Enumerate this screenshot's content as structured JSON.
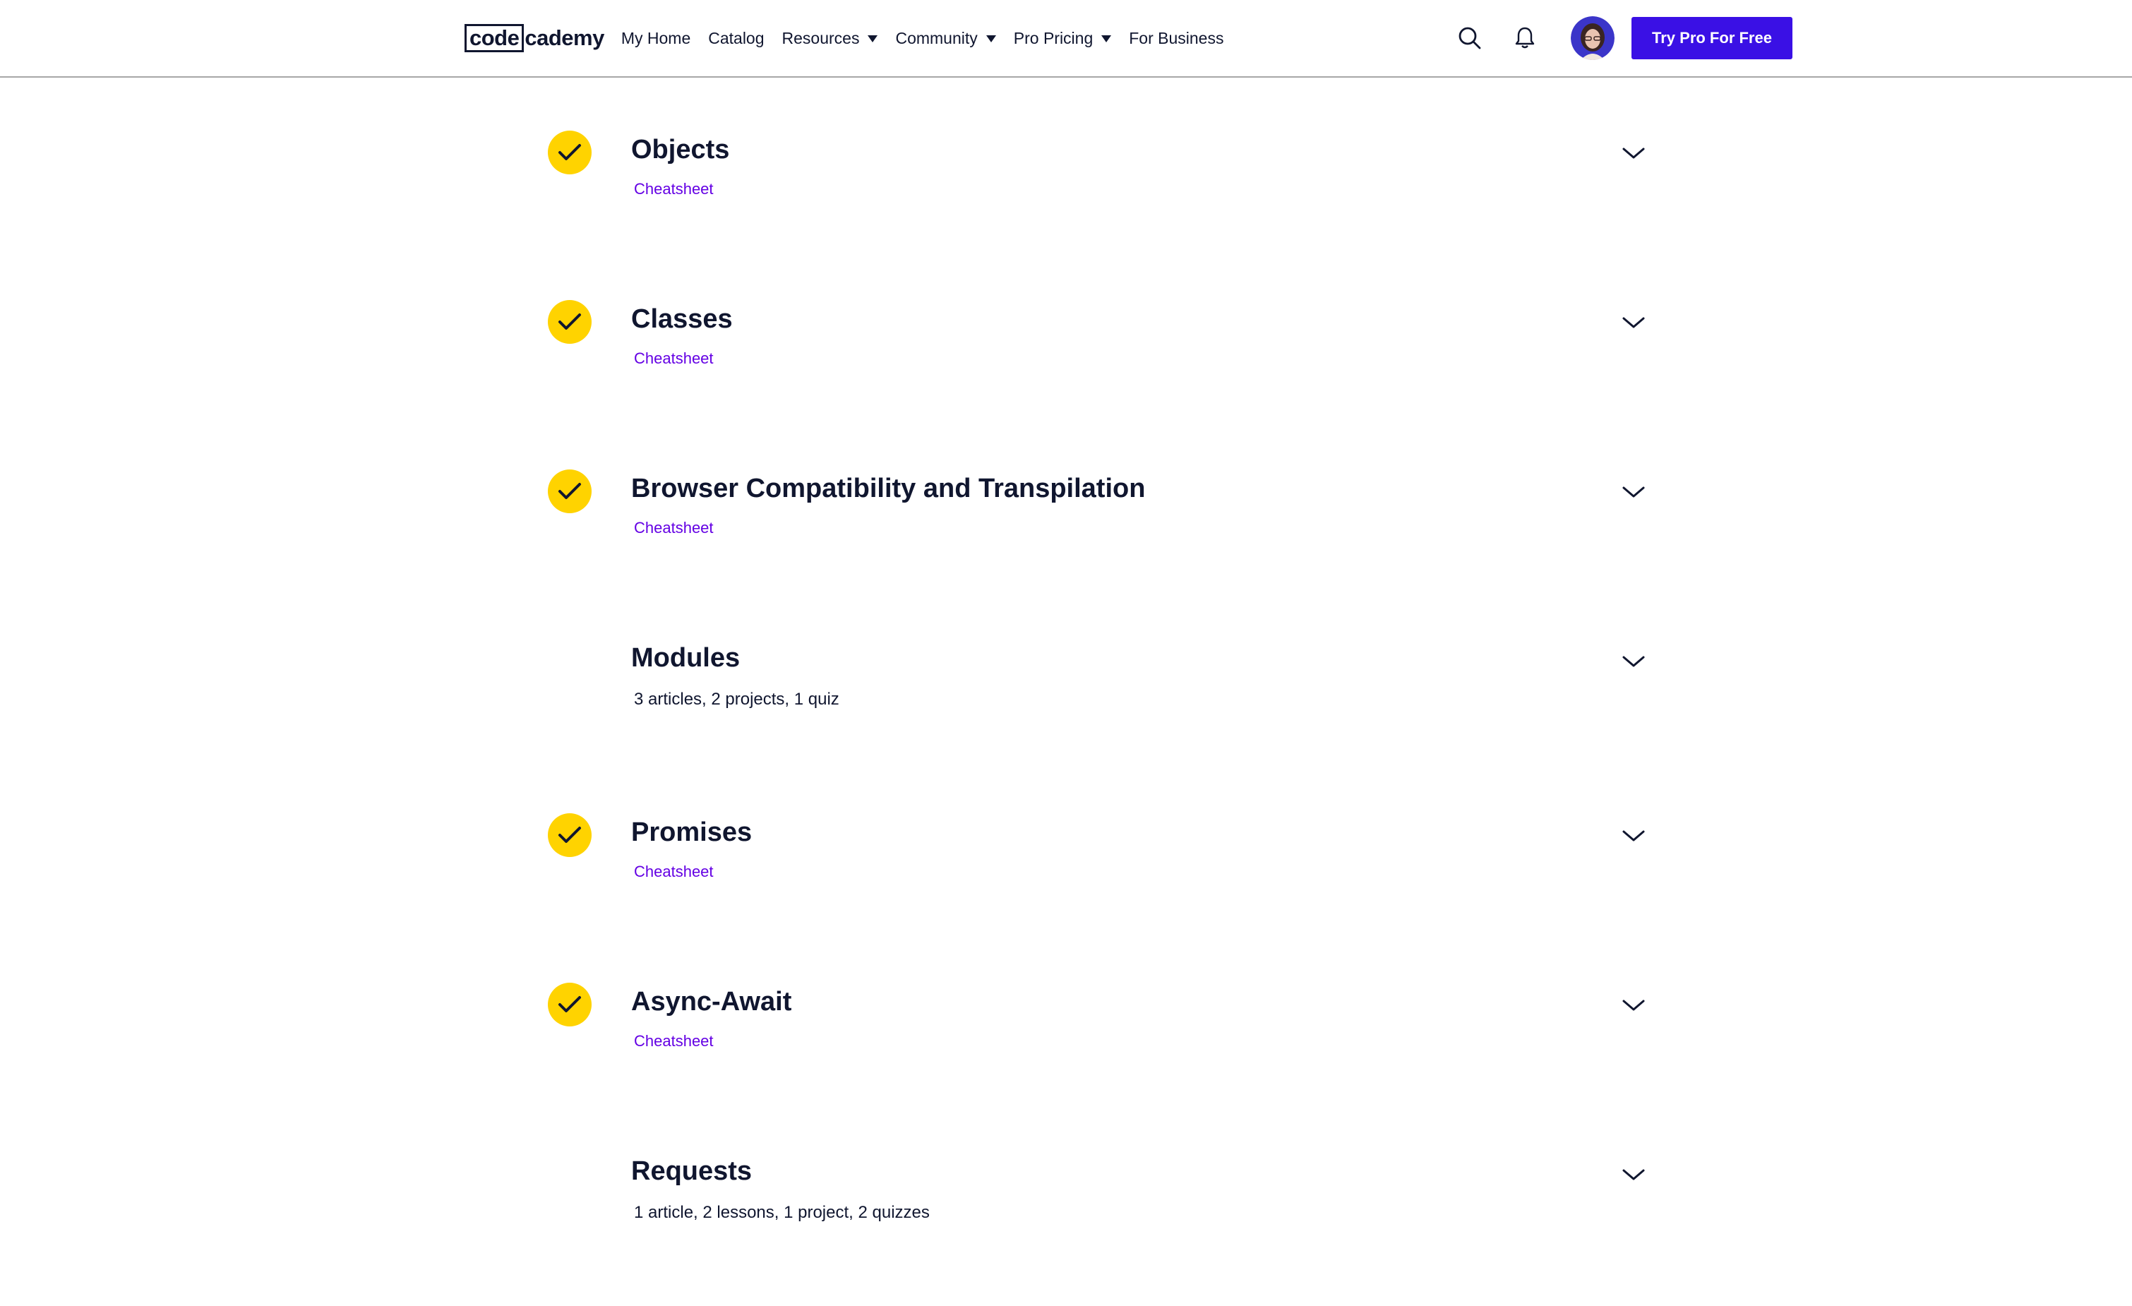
{
  "header": {
    "logo_part1": "code",
    "logo_part2": "cademy",
    "nav": [
      {
        "label": "My Home",
        "dropdown": false
      },
      {
        "label": "Catalog",
        "dropdown": false
      },
      {
        "label": "Resources",
        "dropdown": true
      },
      {
        "label": "Community",
        "dropdown": true
      },
      {
        "label": "Pro Pricing",
        "dropdown": true
      },
      {
        "label": "For Business",
        "dropdown": false
      }
    ],
    "icons": [
      "search-icon",
      "bell-icon",
      "avatar"
    ],
    "cta_label": "Try Pro For Free",
    "accent_color": "#3a10e5"
  },
  "modules": [
    {
      "title": "Objects",
      "completed": true,
      "subtitle": "Cheatsheet"
    },
    {
      "title": "Classes",
      "completed": true,
      "subtitle": "Cheatsheet"
    },
    {
      "title": "Browser Compatibility and Transpilation",
      "completed": true,
      "subtitle": "Cheatsheet"
    },
    {
      "title": "Modules",
      "completed": false,
      "subtitle": "3 articles, 2 projects, 1 quiz"
    },
    {
      "title": "Promises",
      "completed": true,
      "subtitle": "Cheatsheet"
    },
    {
      "title": "Async-Await",
      "completed": true,
      "subtitle": "Cheatsheet"
    },
    {
      "title": "Requests",
      "completed": false,
      "subtitle": "1 article, 2 lessons, 1 project, 2 quizzes"
    }
  ],
  "colors": {
    "check_badge": "#ffd300",
    "link": "#6400e4",
    "text": "#10162f"
  }
}
